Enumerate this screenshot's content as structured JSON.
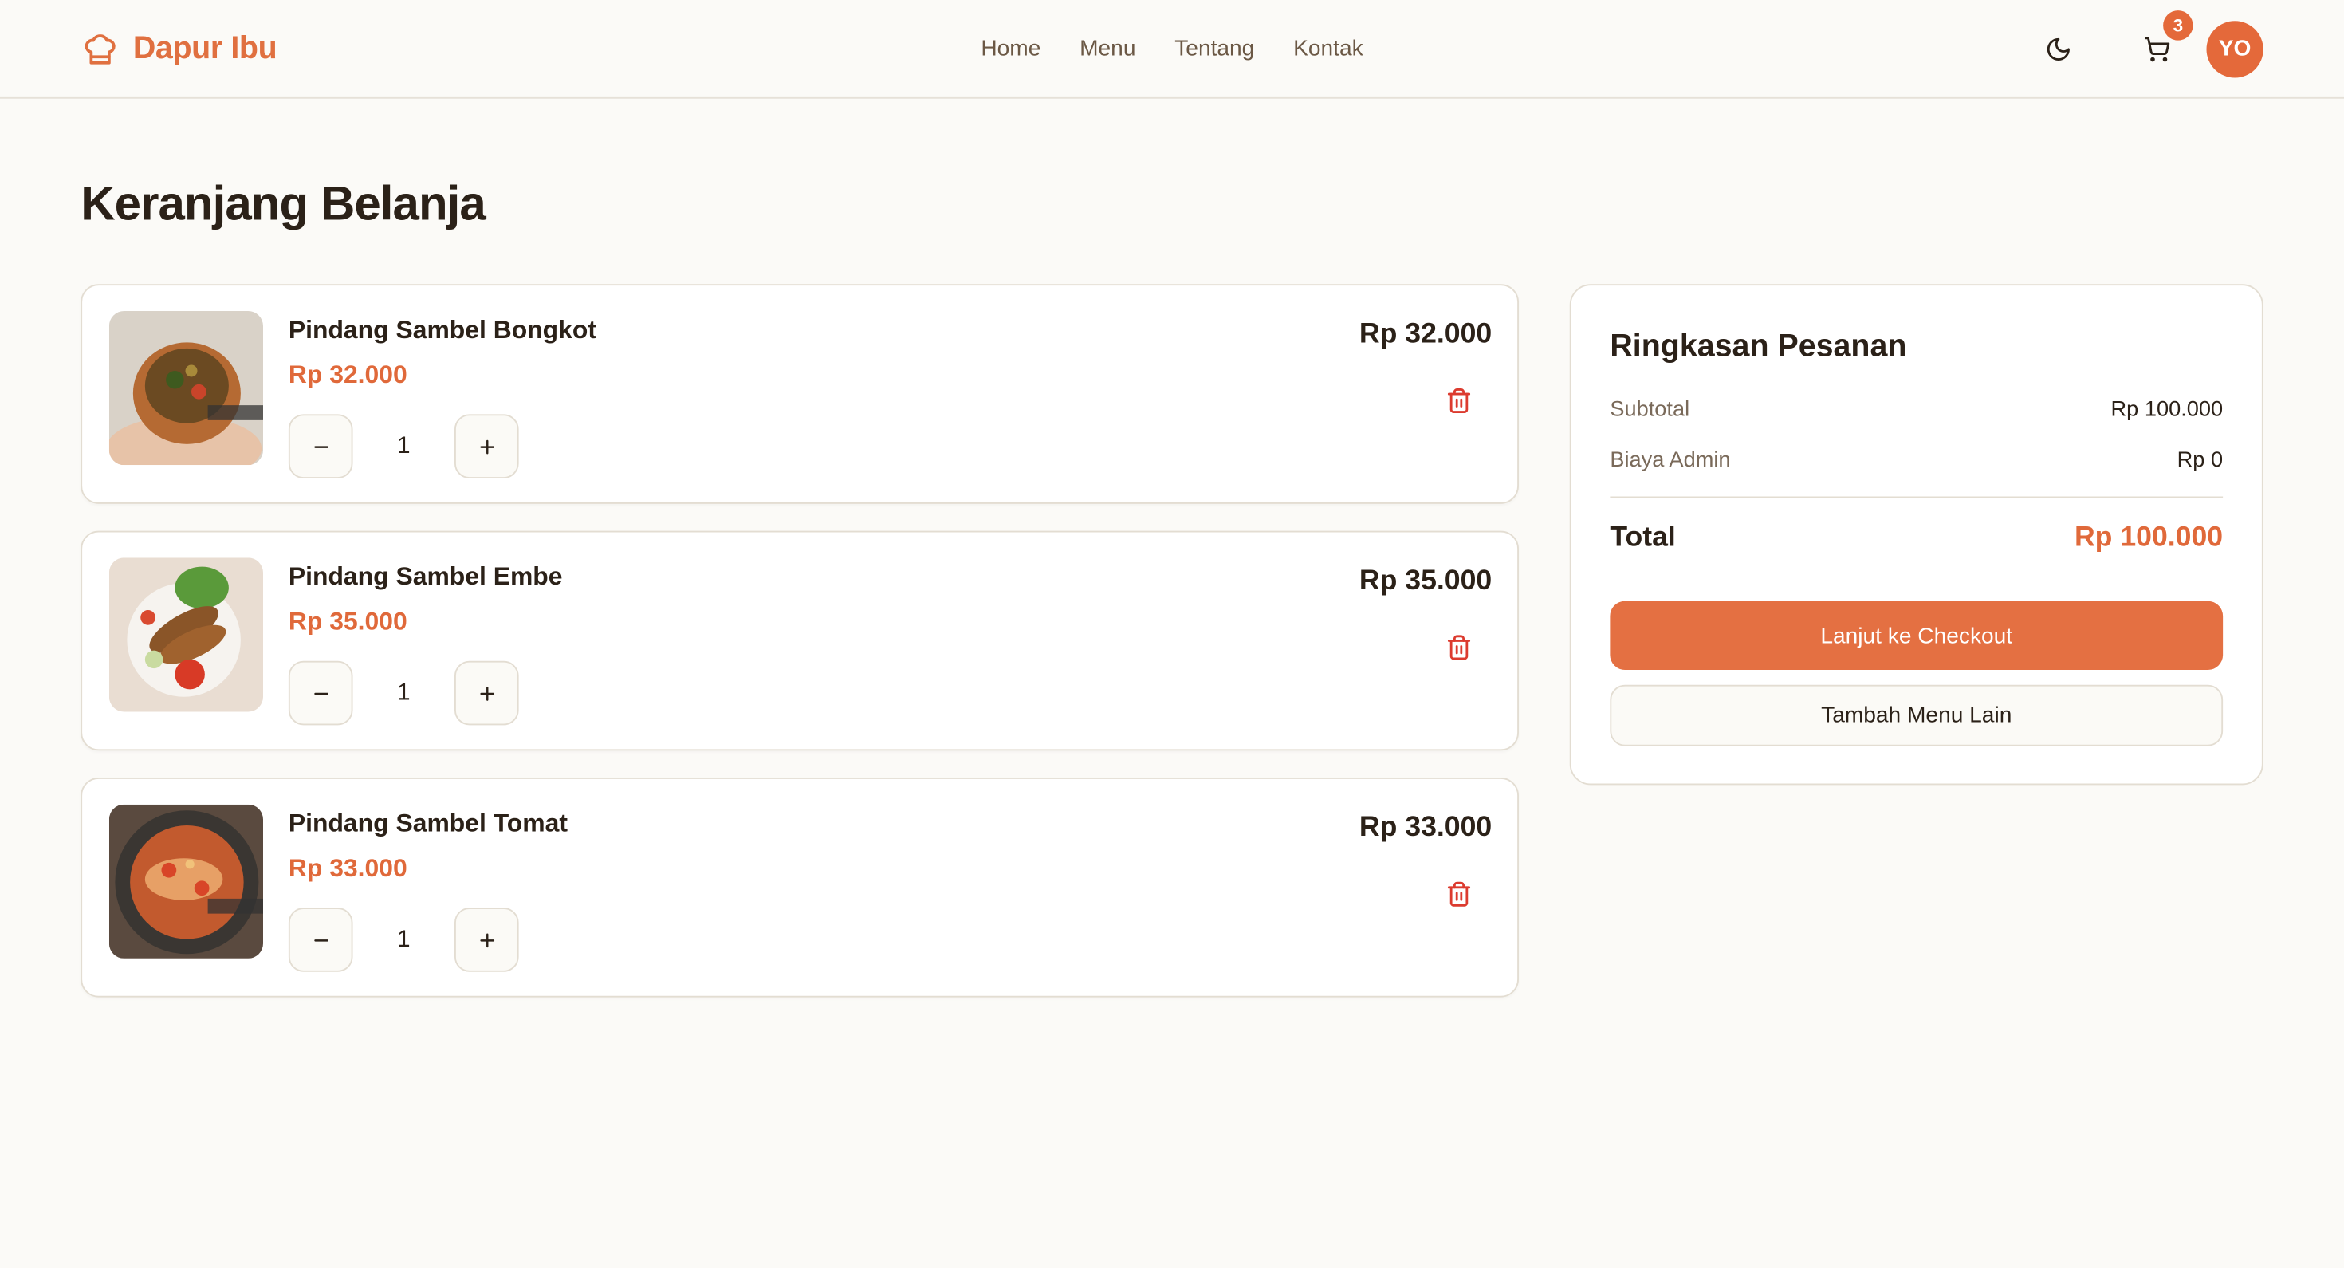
{
  "header": {
    "brand": "Dapur Ibu",
    "nav": [
      "Home",
      "Menu",
      "Tentang",
      "Kontak"
    ],
    "cart_count": "3",
    "avatar_initials": "YO"
  },
  "page": {
    "title": "Keranjang Belanja"
  },
  "cart": {
    "items": [
      {
        "name": "Pindang Sambel Bongkot",
        "price": "Rp 32.000",
        "qty": "1",
        "total": "Rp 32.000"
      },
      {
        "name": "Pindang Sambel Embe",
        "price": "Rp 35.000",
        "qty": "1",
        "total": "Rp 35.000"
      },
      {
        "name": "Pindang Sambel Tomat",
        "price": "Rp 33.000",
        "qty": "1",
        "total": "Rp 33.000"
      }
    ]
  },
  "summary": {
    "title": "Ringkasan Pesanan",
    "subtotal_label": "Subtotal",
    "subtotal_value": "Rp 100.000",
    "admin_label": "Biaya Admin",
    "admin_value": "Rp 0",
    "total_label": "Total",
    "total_value": "Rp 100.000",
    "checkout_label": "Lanjut ke Checkout",
    "add_more_label": "Tambah Menu Lain"
  },
  "colors": {
    "accent": "#e4693a",
    "background": "#fbfaf7",
    "border": "#e3ddd2"
  },
  "icons": [
    "chef-hat-icon",
    "moon-icon",
    "cart-icon",
    "minus-icon",
    "plus-icon",
    "trash-icon"
  ]
}
